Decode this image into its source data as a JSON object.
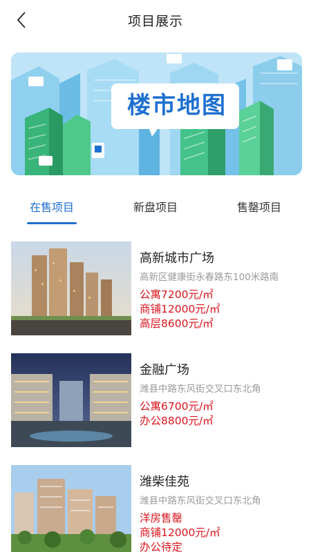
{
  "header": {
    "title": "项目展示"
  },
  "banner": {
    "title": "楼市地图"
  },
  "tabs": [
    {
      "label": "在售项目",
      "active": true
    },
    {
      "label": "新盘项目",
      "active": false
    },
    {
      "label": "售罄项目",
      "active": false
    }
  ],
  "projects": [
    {
      "name": "高新城市广场",
      "address": "高新区健康街永春路东100米路南",
      "prices": [
        "公寓7200元/㎡",
        "商铺12000元/㎡",
        "高层8600元/㎡"
      ]
    },
    {
      "name": "金融广场",
      "address": "潍县中路东风街交叉口东北角",
      "prices": [
        "公寓6700元/㎡",
        "办公8800元/㎡"
      ]
    },
    {
      "name": "潍柴佳苑",
      "address": "潍县中路东风街交叉口东北角",
      "prices": [
        "洋房售罄",
        "商铺12000元/㎡",
        "办公待定"
      ]
    }
  ],
  "colors": {
    "accent": "#1d6fce",
    "price": "#d9141d",
    "muted": "#9a9a9a"
  }
}
